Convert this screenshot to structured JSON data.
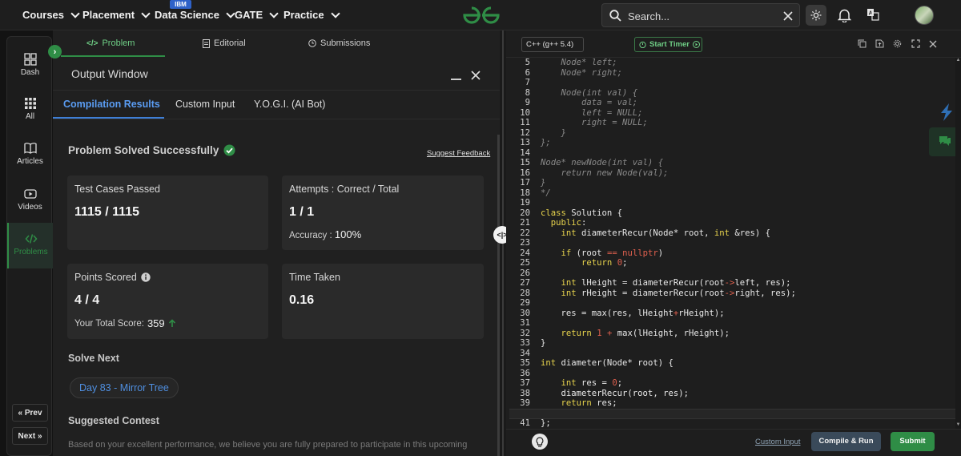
{
  "nav": {
    "items": [
      {
        "label": "Courses"
      },
      {
        "label": "Placement"
      },
      {
        "label": "Data Science"
      },
      {
        "label": "GATE"
      },
      {
        "label": "Practice"
      }
    ],
    "badge": "IBM",
    "search_placeholder": "Search..."
  },
  "rail": {
    "items": [
      {
        "label": "Dash"
      },
      {
        "label": "All"
      },
      {
        "label": "Articles"
      },
      {
        "label": "Videos"
      },
      {
        "label": "Problems"
      }
    ],
    "prev": "Prev",
    "next": "Next"
  },
  "problem_tabs": [
    "Problem",
    "Editorial",
    "Submissions"
  ],
  "output": {
    "title": "Output Window",
    "tabs": [
      "Compilation Results",
      "Custom Input",
      "Y.O.G.I. (AI Bot)"
    ],
    "status": "Problem Solved Successfully",
    "feedback": "Suggest Feedback",
    "cards": {
      "tests_label": "Test Cases Passed",
      "tests_value": "1115 / 1115",
      "attempts_label": "Attempts : Correct / Total",
      "attempts_value": "1 / 1",
      "accuracy_label": "Accuracy :",
      "accuracy_value": "100%",
      "points_label": "Points Scored",
      "points_value": "4 / 4",
      "total_label": "Your Total Score:",
      "total_value": "359",
      "time_label": "Time Taken",
      "time_value": "0.16"
    },
    "solve_next_label": "Solve Next",
    "solve_next_item": "Day 83 - Mirror Tree",
    "contest_label": "Suggested Contest",
    "contest_text": "Based on your excellent performance, we believe you are fully prepared to participate in this upcoming"
  },
  "editor": {
    "language": "C++ (g++ 5.4)",
    "timer": "Start Timer",
    "custom_input": "Custom Input",
    "compile": "Compile & Run",
    "submit": "Submit",
    "code": [
      {
        "n": "5",
        "t": "    Node* left;",
        "c": "cm"
      },
      {
        "n": "6",
        "t": "    Node* right;",
        "c": "cm"
      },
      {
        "n": "7",
        "t": "",
        "c": ""
      },
      {
        "n": "8",
        "t": "    Node(int val) {",
        "c": "cm"
      },
      {
        "n": "9",
        "t": "        data = val;",
        "c": "cm"
      },
      {
        "n": "10",
        "t": "        left = NULL;",
        "c": "cm"
      },
      {
        "n": "11",
        "t": "        right = NULL;",
        "c": "cm"
      },
      {
        "n": "12",
        "t": "    }",
        "c": "cm"
      },
      {
        "n": "13",
        "t": "};",
        "c": "cm"
      },
      {
        "n": "14",
        "t": "",
        "c": ""
      },
      {
        "n": "15",
        "t": "Node* newNode(int val) {",
        "c": "cm"
      },
      {
        "n": "16",
        "t": "    return new Node(val);",
        "c": "cm"
      },
      {
        "n": "17",
        "t": "}",
        "c": "cm"
      },
      {
        "n": "18",
        "t": "*/",
        "c": "cm"
      },
      {
        "n": "19",
        "t": "",
        "c": ""
      },
      {
        "n": "20",
        "t": "class Solution {",
        "c": ""
      },
      {
        "n": "21",
        "t": "  public:",
        "c": ""
      },
      {
        "n": "22",
        "t": "    int diameterRecur(Node* root, int &res) {",
        "c": ""
      },
      {
        "n": "23",
        "t": "",
        "c": ""
      },
      {
        "n": "24",
        "t": "    if (root == nullptr)",
        "c": ""
      },
      {
        "n": "25",
        "t": "        return 0;",
        "c": ""
      },
      {
        "n": "26",
        "t": "",
        "c": ""
      },
      {
        "n": "27",
        "t": "    int lHeight = diameterRecur(root->left, res);",
        "c": ""
      },
      {
        "n": "28",
        "t": "    int rHeight = diameterRecur(root->right, res);",
        "c": ""
      },
      {
        "n": "29",
        "t": "",
        "c": ""
      },
      {
        "n": "30",
        "t": "    res = max(res, lHeight+rHeight);",
        "c": ""
      },
      {
        "n": "31",
        "t": "",
        "c": ""
      },
      {
        "n": "32",
        "t": "    return 1 + max(lHeight, rHeight);",
        "c": ""
      },
      {
        "n": "33",
        "t": "}",
        "c": ""
      },
      {
        "n": "34",
        "t": "",
        "c": ""
      },
      {
        "n": "35",
        "t": "int diameter(Node* root) {",
        "c": ""
      },
      {
        "n": "36",
        "t": "",
        "c": ""
      },
      {
        "n": "37",
        "t": "    int res = 0;",
        "c": ""
      },
      {
        "n": "38",
        "t": "    diameterRecur(root, res);",
        "c": ""
      },
      {
        "n": "39",
        "t": "    return res;",
        "c": ""
      },
      {
        "n": "40",
        "t": "}",
        "c": ""
      },
      {
        "n": "41",
        "t": "};",
        "c": ""
      }
    ]
  }
}
